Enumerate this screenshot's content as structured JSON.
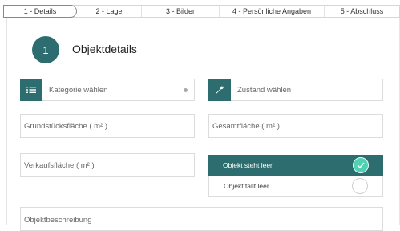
{
  "steps": [
    {
      "label": "1 - Details"
    },
    {
      "label": "2 - Lage"
    },
    {
      "label": "3 - Bilder"
    },
    {
      "label": "4 - Persönliche Angaben"
    },
    {
      "label": "5 - Abschluss"
    }
  ],
  "section": {
    "number": "1",
    "title": "Objektdetails"
  },
  "category_select": {
    "label": "Kategorie wählen",
    "icon": "list-icon"
  },
  "condition_select": {
    "label": "Zustand wählen",
    "icon": "wrench-icon"
  },
  "fields": {
    "plot_area": "Grundstücksfläche ( m² )",
    "total_area": "Gesamtfläche ( m² )",
    "sales_area": "Verkaufsfläche ( m² )",
    "description": "Objektbeschreibung"
  },
  "vacancy": {
    "option_on": "Objekt steht leer",
    "option_off": "Objekt fällt leer"
  },
  "colors": {
    "accent": "#2d6d6f",
    "check": "#4fd1b4"
  }
}
